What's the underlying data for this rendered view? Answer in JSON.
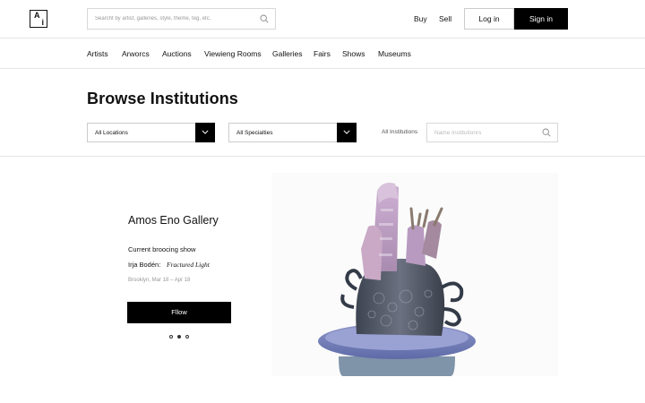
{
  "header": {
    "logo_letter_top": "A",
    "logo_letter_bottom": "i",
    "search_placeholder": "Searcht by artist, galleries, style, theme, teg, etc.",
    "buy_label": "Buy",
    "sell_label": "Sell",
    "login_label": "Log in",
    "signin_label": "Sign in"
  },
  "subnav": {
    "items": [
      "Artists",
      "Arworcs",
      "Auctions",
      "Viewieng Rooms",
      "Galleries",
      "Fairs",
      "Shows",
      "Museums"
    ]
  },
  "main": {
    "title": "Browse Institutions",
    "filters": {
      "locations_label": "All Locations",
      "specialties_label": "All Specialties",
      "institutions_label": "All Institutions",
      "name_placeholder": "Name Institutionrs"
    },
    "featured": {
      "name": "Amos Eno Gallery",
      "show_status": "Current broocing show",
      "artist": "Irja Bodén:",
      "show_title": "Fractured Light",
      "meta": "Brooklyn, Mar 18 – Apr 18",
      "follow_label": "Fllow",
      "carousel_count": 3,
      "carousel_active": 2
    }
  },
  "icons": {
    "search": "search-icon",
    "dropdown": "chevron-down-icon"
  },
  "colors": {
    "primary": "#000000",
    "border": "#d8d8d8",
    "muted_text": "#999999"
  }
}
